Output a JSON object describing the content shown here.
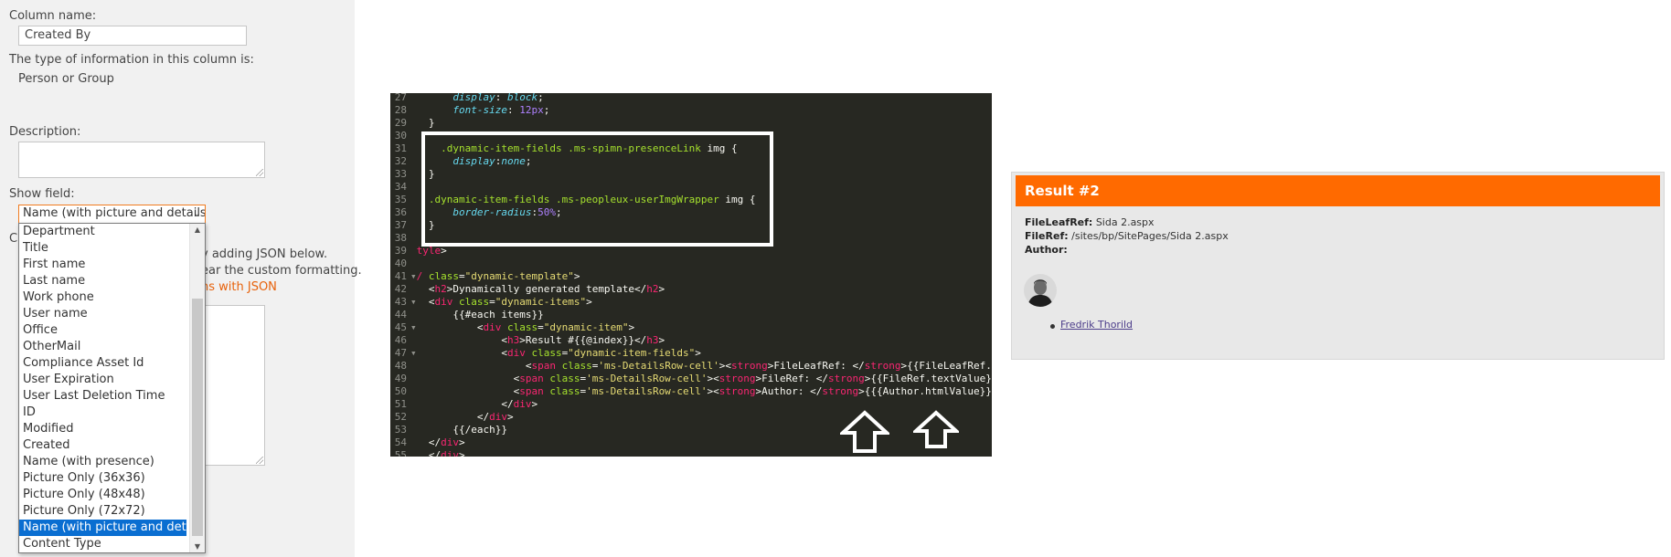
{
  "settings": {
    "column_name_label": "Column name:",
    "column_name_value": "Created By",
    "type_label": "The type of information in this column is:",
    "type_value": "Person or Group",
    "description_label": "Description:",
    "show_field_label": "Show field:",
    "show_field_selected": "Name (with picture and details)",
    "show_field_options": [
      "Department",
      "Title",
      "First name",
      "Last name",
      "Work phone",
      "User name",
      "Office",
      "OtherMail",
      "Compliance Asset Id",
      "User Expiration",
      "User Last Deletion Time",
      "ID",
      "Modified",
      "Created",
      "Name (with presence)",
      "Picture Only (36x36)",
      "Picture Only (48x48)",
      "Picture Only (72x72)",
      "Name (with picture and details)",
      "Content Type"
    ],
    "partial_label_c": "C",
    "partial_text_1": "y adding JSON below.",
    "partial_text_2": "ear the custom formatting.",
    "partial_link": "ns with JSON"
  },
  "result": {
    "title": "Result #2",
    "fileleafref_label": "FileLeafRef:",
    "fileleafref_value": "Sida 2.aspx",
    "fileref_label": "FileRef:",
    "fileref_value": "/sites/bp/SitePages/Sida 2.aspx",
    "author_label": "Author:",
    "author_name": "Fredrik Thorild"
  },
  "code_lines": [
    {
      "n": "27",
      "tokens": [
        [
          "      ",
          "plain"
        ],
        [
          "display",
          "key"
        ],
        [
          ": ",
          "plain"
        ],
        [
          "block",
          "key"
        ],
        [
          ";",
          "plain"
        ]
      ]
    },
    {
      "n": "28",
      "tokens": [
        [
          "      ",
          "plain"
        ],
        [
          "font-size",
          "key"
        ],
        [
          ": ",
          "plain"
        ],
        [
          "12px",
          "num"
        ],
        [
          ";",
          "plain"
        ]
      ]
    },
    {
      "n": "29",
      "tokens": [
        [
          "  }",
          "plain"
        ]
      ]
    },
    {
      "n": "30",
      "tokens": []
    },
    {
      "n": "31",
      "tokens": [
        [
          "    ",
          "plain"
        ],
        [
          ".dynamic-item-fields .ms-spimn-presenceLink",
          "cls"
        ],
        [
          " img {",
          "plain"
        ]
      ]
    },
    {
      "n": "32",
      "tokens": [
        [
          "      ",
          "plain"
        ],
        [
          "display",
          "key"
        ],
        [
          ":",
          "plain"
        ],
        [
          "none",
          "key"
        ],
        [
          ";",
          "plain"
        ]
      ]
    },
    {
      "n": "33",
      "tokens": [
        [
          "  }",
          "plain"
        ]
      ]
    },
    {
      "n": "34",
      "tokens": []
    },
    {
      "n": "35",
      "tokens": [
        [
          "  ",
          "plain"
        ],
        [
          ".dynamic-item-fields .ms-peopleux-userImgWrapper",
          "cls"
        ],
        [
          " img {",
          "plain"
        ]
      ]
    },
    {
      "n": "36",
      "tokens": [
        [
          "      ",
          "plain"
        ],
        [
          "border-radius",
          "key"
        ],
        [
          ":",
          "plain"
        ],
        [
          "50%",
          "num"
        ],
        [
          ";",
          "plain"
        ]
      ]
    },
    {
      "n": "37",
      "tokens": [
        [
          "  }",
          "plain"
        ]
      ]
    },
    {
      "n": "38",
      "tokens": []
    },
    {
      "n": "39",
      "tokens": [
        [
          "tyle",
          "tag"
        ],
        [
          ">",
          "plain"
        ]
      ]
    },
    {
      "n": "40",
      "tokens": []
    },
    {
      "n": "41",
      "fold": true,
      "tokens": [
        [
          "/ ",
          "tag"
        ],
        [
          "class",
          "cls"
        ],
        [
          "=",
          "plain"
        ],
        [
          "\"dynamic-template\"",
          "str"
        ],
        [
          ">",
          "plain"
        ]
      ]
    },
    {
      "n": "42",
      "tokens": [
        [
          "  <",
          "plain"
        ],
        [
          "h2",
          "tag"
        ],
        [
          ">Dynamically generated template</",
          "plain"
        ],
        [
          "h2",
          "tag"
        ],
        [
          ">",
          "plain"
        ]
      ]
    },
    {
      "n": "43",
      "fold": true,
      "tokens": [
        [
          "  <",
          "plain"
        ],
        [
          "div",
          "tag"
        ],
        [
          " ",
          "plain"
        ],
        [
          "class",
          "cls"
        ],
        [
          "=",
          "plain"
        ],
        [
          "\"dynamic-items\"",
          "str"
        ],
        [
          ">",
          "plain"
        ]
      ]
    },
    {
      "n": "44",
      "tokens": [
        [
          "      {{#each items}}",
          "plain"
        ]
      ]
    },
    {
      "n": "45",
      "fold": true,
      "tokens": [
        [
          "          <",
          "plain"
        ],
        [
          "div",
          "tag"
        ],
        [
          " ",
          "plain"
        ],
        [
          "class",
          "cls"
        ],
        [
          "=",
          "plain"
        ],
        [
          "\"dynamic-item\"",
          "str"
        ],
        [
          ">",
          "plain"
        ]
      ]
    },
    {
      "n": "46",
      "tokens": [
        [
          "              <",
          "plain"
        ],
        [
          "h3",
          "tag"
        ],
        [
          ">Result #{{@index}}</",
          "plain"
        ],
        [
          "h3",
          "tag"
        ],
        [
          ">",
          "plain"
        ]
      ]
    },
    {
      "n": "47",
      "fold": true,
      "tokens": [
        [
          "              <",
          "plain"
        ],
        [
          "div",
          "tag"
        ],
        [
          " ",
          "plain"
        ],
        [
          "class",
          "cls"
        ],
        [
          "=",
          "plain"
        ],
        [
          "\"dynamic-item-fields\"",
          "str"
        ],
        [
          ">",
          "plain"
        ]
      ]
    },
    {
      "n": "48",
      "tokens": [
        [
          "                  <",
          "plain"
        ],
        [
          "span",
          "tag"
        ],
        [
          " ",
          "plain"
        ],
        [
          "class",
          "cls"
        ],
        [
          "=",
          "plain"
        ],
        [
          "'ms-DetailsRow-cell'",
          "str"
        ],
        [
          "><",
          "plain"
        ],
        [
          "strong",
          "tag"
        ],
        [
          ">FileLeafRef: </",
          "plain"
        ],
        [
          "strong",
          "tag"
        ],
        [
          ">{{FileLeafRef.te",
          "plain"
        ]
      ]
    },
    {
      "n": "49",
      "tokens": [
        [
          "                <",
          "plain"
        ],
        [
          "span",
          "tag"
        ],
        [
          " ",
          "plain"
        ],
        [
          "class",
          "cls"
        ],
        [
          "=",
          "plain"
        ],
        [
          "'ms-DetailsRow-cell'",
          "str"
        ],
        [
          "><",
          "plain"
        ],
        [
          "strong",
          "tag"
        ],
        [
          ">FileRef: </",
          "plain"
        ],
        [
          "strong",
          "tag"
        ],
        [
          ">{{FileRef.textValue}}<",
          "plain"
        ]
      ]
    },
    {
      "n": "50",
      "tokens": [
        [
          "                <",
          "plain"
        ],
        [
          "span",
          "tag"
        ],
        [
          " ",
          "plain"
        ],
        [
          "class",
          "cls"
        ],
        [
          "=",
          "plain"
        ],
        [
          "'ms-DetailsRow-cell'",
          "str"
        ],
        [
          "><",
          "plain"
        ],
        [
          "strong",
          "tag"
        ],
        [
          ">Author: </",
          "plain"
        ],
        [
          "strong",
          "tag"
        ],
        [
          ">{{{Author.htmlValue}}}<",
          "plain"
        ]
      ]
    },
    {
      "n": "51",
      "tokens": [
        [
          "              </",
          "plain"
        ],
        [
          "div",
          "tag"
        ],
        [
          ">",
          "plain"
        ]
      ]
    },
    {
      "n": "52",
      "tokens": [
        [
          "          </",
          "plain"
        ],
        [
          "div",
          "tag"
        ],
        [
          ">",
          "plain"
        ]
      ]
    },
    {
      "n": "53",
      "tokens": [
        [
          "      {{/each}}",
          "plain"
        ]
      ]
    },
    {
      "n": "54",
      "tokens": [
        [
          "  </",
          "plain"
        ],
        [
          "div",
          "tag"
        ],
        [
          ">",
          "plain"
        ]
      ]
    },
    {
      "n": "55",
      "tokens": [
        [
          "  </",
          "plain"
        ],
        [
          "div",
          "tag"
        ],
        [
          ">",
          "plain"
        ]
      ]
    }
  ],
  "colors": {
    "accent_orange": "#ff6a00",
    "selection_blue": "#0a6ed1",
    "editor_bg": "#272822"
  }
}
